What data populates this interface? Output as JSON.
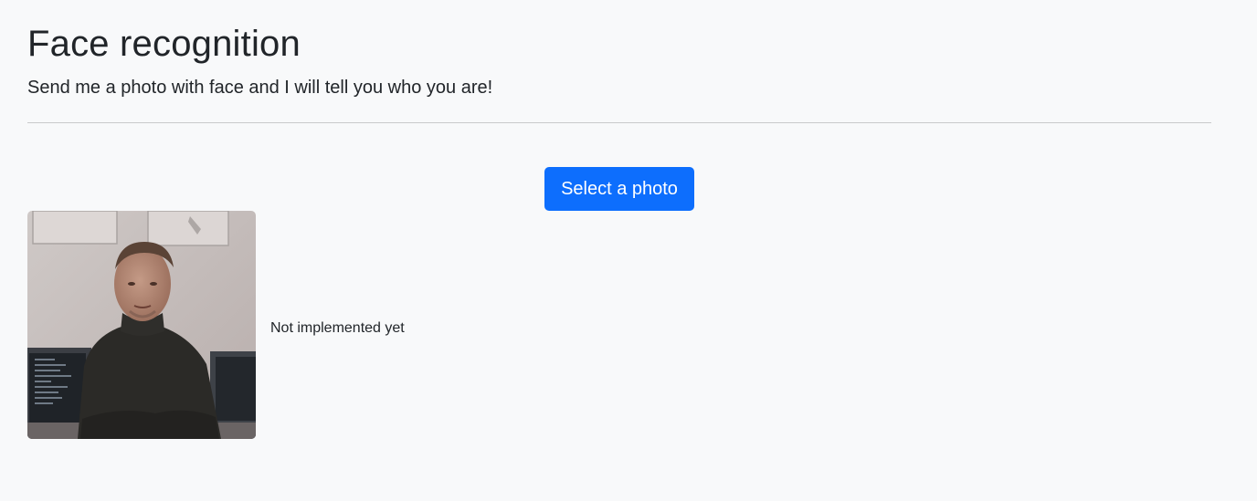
{
  "header": {
    "title": "Face recognition",
    "subtitle": "Send me a photo with face and I will tell you who you are!"
  },
  "upload": {
    "button_label": "Select a photo"
  },
  "result": {
    "photo_alt": "uploaded-face-photo",
    "status_text": "Not implemented yet"
  },
  "colors": {
    "background": "#f8f9fa",
    "primary": "#0d6efd",
    "text": "#212529",
    "divider": "#c8c9ca"
  }
}
